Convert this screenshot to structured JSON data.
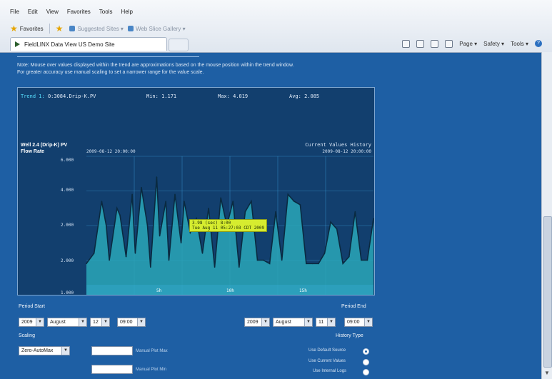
{
  "browser": {
    "menu": [
      "File",
      "Edit",
      "View",
      "Favorites",
      "Tools",
      "Help"
    ],
    "favorites_label": "Favorites",
    "fav_links": [
      "Suggested Sites ▾",
      "Web Slice Gallery ▾"
    ],
    "tab_title": "FieldLINX Data View US Demo Site",
    "commands": [
      "Page ▾",
      "Safety ▾",
      "Tools ▾"
    ]
  },
  "note": {
    "line1": "Note: Mouse over values displayed within the trend are approximations based on the mouse position within the trend window.",
    "line2": "For greater accuracy use manual scaling to set a narrower range for the value scale."
  },
  "chart_header": {
    "trend_label": "Trend 1:",
    "trend_tag": "0:3084.Drip-K.PV",
    "min": "Min: 1.171",
    "max": "Max: 4.819",
    "avg": "Avg: 2.085",
    "series_line1": "Well 2.4 (Drip-K) PV",
    "series_line2": "Flow Rate",
    "start_ts": "2009-08-12 20:00:00",
    "history_title": "Current Values History",
    "end_ts": "2009-08-12 20:00:00",
    "tooltip_line1": "3.98 (sec) 8:00",
    "tooltip_line2": "Tue Aug 11 05:27:03 CDT 2009"
  },
  "chart_data": {
    "type": "area",
    "ylim": [
      1.0,
      5.0
    ],
    "yticks": [
      "6.000",
      "4.000",
      "2.000",
      "2.000",
      "1.000"
    ],
    "xticks": [
      "5h",
      "10h",
      "15h"
    ],
    "x": [
      0,
      0.5,
      1,
      1.3,
      1.5,
      2,
      2.2,
      2.6,
      3,
      3.2,
      3.6,
      4,
      4.2,
      4.6,
      4.8,
      5.2,
      5.4,
      5.8,
      6.2,
      6.4,
      6.8,
      7.2,
      7.6,
      8,
      8.4,
      8.8,
      9.2,
      9.6,
      10,
      10.4,
      10.8,
      11.2,
      11.6,
      12,
      12.4,
      12.8,
      13.2,
      13.6,
      14,
      14.4,
      14.8,
      15.2,
      15.6,
      16,
      16.4,
      16.8,
      17.2,
      17.6,
      18,
      18.4,
      18.8
    ],
    "values": [
      1.9,
      2.2,
      3.7,
      3.0,
      2.0,
      3.5,
      3.3,
      2.1,
      3.9,
      2.2,
      4.1,
      3.0,
      1.8,
      4.4,
      2.7,
      3.7,
      2.0,
      3.9,
      2.5,
      3.7,
      2.8,
      3.2,
      2.2,
      3.5,
      1.8,
      3.8,
      3.0,
      3.7,
      1.8,
      3.4,
      3.7,
      2.0,
      2.0,
      1.9,
      3.4,
      2.0,
      3.9,
      3.7,
      3.6,
      1.9,
      1.9,
      1.9,
      2.2,
      3.1,
      2.9,
      1.9,
      2.1,
      3.4,
      2.0,
      2.0,
      3.2
    ],
    "xlim": [
      0,
      18.8
    ],
    "color_fill": "#2aa7b8",
    "color_line": "#0a2a40",
    "grid_color": "#3fa9e6"
  },
  "controls": {
    "period_start_label": "Period Start",
    "period_end_label": "Period End",
    "start_year": "2009",
    "start_month": "August",
    "start_day": "12",
    "start_time": "09:00",
    "end_year": "2009",
    "end_month": "August",
    "end_day": "11",
    "end_time": "09:00",
    "scaling_label": "Scaling",
    "scaling_value": "Zero-AutoMax",
    "manual_max_label": "Manual Plot Max",
    "manual_min_label": "Manual Plot Min",
    "history_type_label": "History Type",
    "opt1": "Use Default Source",
    "opt2": "Use Current Values",
    "opt3": "Use Internal Logs"
  }
}
